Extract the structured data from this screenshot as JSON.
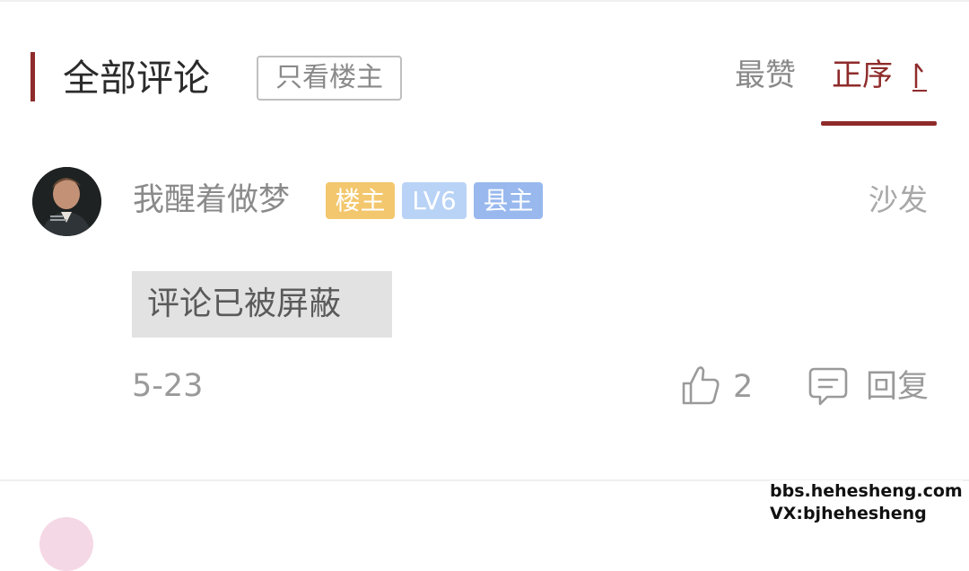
{
  "header": {
    "section_title": "全部评论",
    "owner_only_label": "只看楼主",
    "sort_likes_label": "最赞",
    "sort_order_label": "正序",
    "accent_color": "#8f2b2b"
  },
  "comment": {
    "username": "我醒着做梦",
    "badges": {
      "owner": "楼主",
      "level": "LV6",
      "title": "县主"
    },
    "floor_label": "沙发",
    "content": "评论已被屏蔽",
    "date": "5-23",
    "like_count": "2",
    "reply_label": "回复"
  },
  "watermark": {
    "line1": "bbs.hehesheng.com",
    "line2": "VX:bjhehesheng"
  },
  "icons": [
    "sort-arrow-icon",
    "thumbs-up-icon",
    "comment-bubble-icon"
  ]
}
